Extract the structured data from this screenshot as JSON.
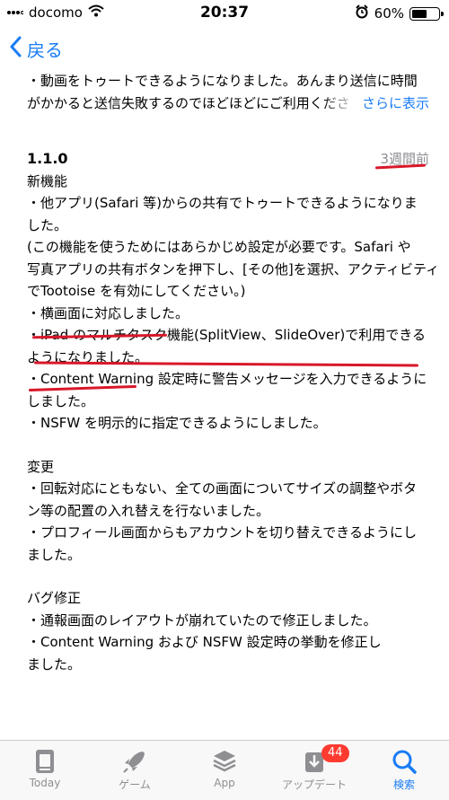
{
  "status": {
    "carrier": "docomo",
    "time": "20:37",
    "battery": "60%",
    "battery_level": 0.6
  },
  "nav": {
    "back_label": "戻る"
  },
  "top_text": {
    "line1": "・動画をトゥートできるようになりました。あんまり送信に時間",
    "line2": "がかかると送信失敗するのでほどほどにご利用くださ",
    "more_label": "さらに表示"
  },
  "release": {
    "version": "1.1.0",
    "ago": "3週間前"
  },
  "sections": {
    "new": {
      "heading": "新機能",
      "lines": [
        "・他アプリ(Safari 等)からの共有でトゥートできるようになりま",
        "した。",
        " (この機能を使うためにはあらかじめ設定が必要です。Safari や",
        "写真アプリの共有ボタンを押下し、[その他]を選択、アクティビティ",
        "でTootoise を有効にしてください。)",
        "・横画面に対応しました。",
        "・iPad のマルチタスク機能(SplitView、SlideOver)で利用できる",
        "ようになりました。",
        "・Content Warning 設定時に警告メッセージを入力できるように",
        "しました。",
        "・NSFW を明示的に指定できるようにしました。"
      ]
    },
    "change": {
      "heading": "変更",
      "lines": [
        "・回転対応にともない、全ての画面についてサイズの調整やボタ",
        "ン等の配置の入れ替えを行ないました。",
        "・プロフィール画面からもアカウントを切り替えできるようにし",
        "ました。"
      ]
    },
    "bugfix": {
      "heading": "バグ修正",
      "lines": [
        "・通報画面のレイアウトが崩れていたので修正しました。",
        "・Content Warning および NSFW 設定時の挙動を修正し",
        "ました。"
      ]
    }
  },
  "tabbar": {
    "today": "Today",
    "games": "ゲーム",
    "apps": "App",
    "updates": "アップデート",
    "updates_badge": "44",
    "search": "検索"
  }
}
